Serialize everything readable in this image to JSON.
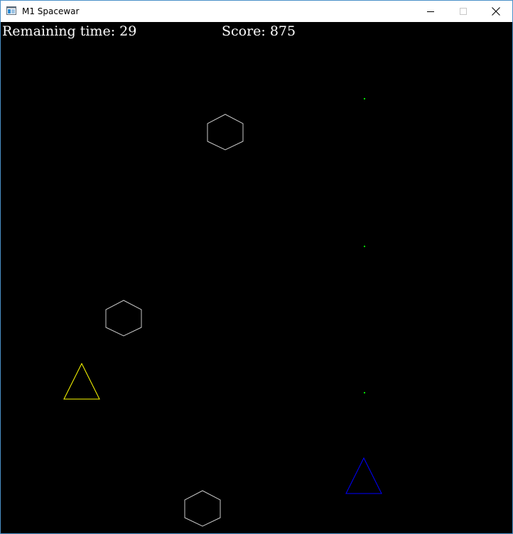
{
  "window": {
    "title": "M1 Spacewar",
    "icon": "app-window-icon",
    "controls": {
      "minimize_icon": "minimize-icon",
      "maximize_icon": "maximize-icon",
      "close_icon": "close-icon"
    },
    "border_color": "#4a90c8"
  },
  "hud": {
    "time_label": "Remaining time:",
    "time_value": "29",
    "score_label": "Score:",
    "score_value": "875",
    "text_color": "#ffffff"
  },
  "game": {
    "background_color": "#000000",
    "player_ship_color": "#ffff00",
    "enemy_ship_color": "#0000ff",
    "asteroid_color": "#c8c8c8",
    "bullet_color": "#00ff00",
    "asteroid_count": 3,
    "bullet_count": 3
  }
}
